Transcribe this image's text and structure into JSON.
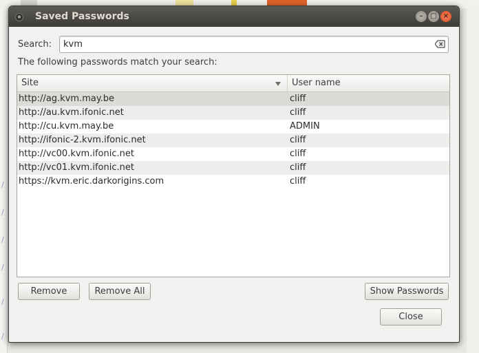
{
  "window": {
    "title": "Saved Passwords"
  },
  "search": {
    "label": "Search:",
    "value": "kvm"
  },
  "match_text": "The following passwords match your search:",
  "columns": {
    "site": "Site",
    "user": "User name"
  },
  "rows": [
    {
      "site": "http://ag.kvm.may.be",
      "user": "cliff"
    },
    {
      "site": "http://au.kvm.ifonic.net",
      "user": "cliff"
    },
    {
      "site": "http://cu.kvm.may.be",
      "user": "ADMIN"
    },
    {
      "site": "http://ifonic-2.kvm.ifonic.net",
      "user": "cliff"
    },
    {
      "site": "http://vc00.kvm.ifonic.net",
      "user": "cliff"
    },
    {
      "site": "http://vc01.kvm.ifonic.net",
      "user": "cliff"
    },
    {
      "site": "https://kvm.eric.darkorigins.com",
      "user": "cliff"
    }
  ],
  "buttons": {
    "remove": "Remove",
    "remove_all": "Remove All",
    "show_passwords": "Show Passwords",
    "close": "Close"
  },
  "colors": {
    "titlebar": "#3d3c38",
    "close_button": "#e0531f",
    "window_bg": "#f2f1f0"
  }
}
